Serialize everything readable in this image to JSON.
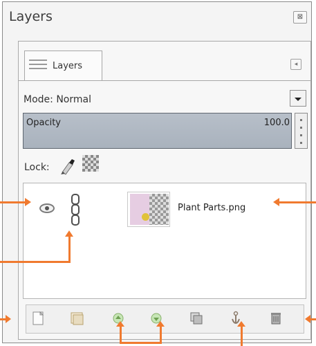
{
  "panel": {
    "title": "Layers",
    "close_glyph": "⊠",
    "tab_label": "Layers",
    "tab_menu_glyph": "◂",
    "mode_label": "Mode:",
    "mode_value": "Normal",
    "opacity_label": "Opacity",
    "opacity_value": "100.0",
    "lock_label": "Lock:",
    "layer_name": "Plant Parts.png"
  },
  "icons": {
    "close": "close-icon",
    "tab": "layers-tab-icon",
    "dropdown": "chevron-down-icon",
    "lock_pixels": "paintbrush-icon",
    "lock_alpha": "checkerboard-icon",
    "visibility": "eye-icon",
    "chain": "chain-link-icon",
    "toolbar": [
      "new-layer-icon",
      "new-group-icon",
      "raise-layer-icon",
      "lower-layer-icon",
      "duplicate-layer-icon",
      "anchor-layer-icon",
      "delete-layer-icon"
    ]
  },
  "colors": {
    "accent_arrow": "#f07a2f",
    "opacity_fill": "#b0b8c3",
    "panel_bg": "#f4f4f4"
  }
}
